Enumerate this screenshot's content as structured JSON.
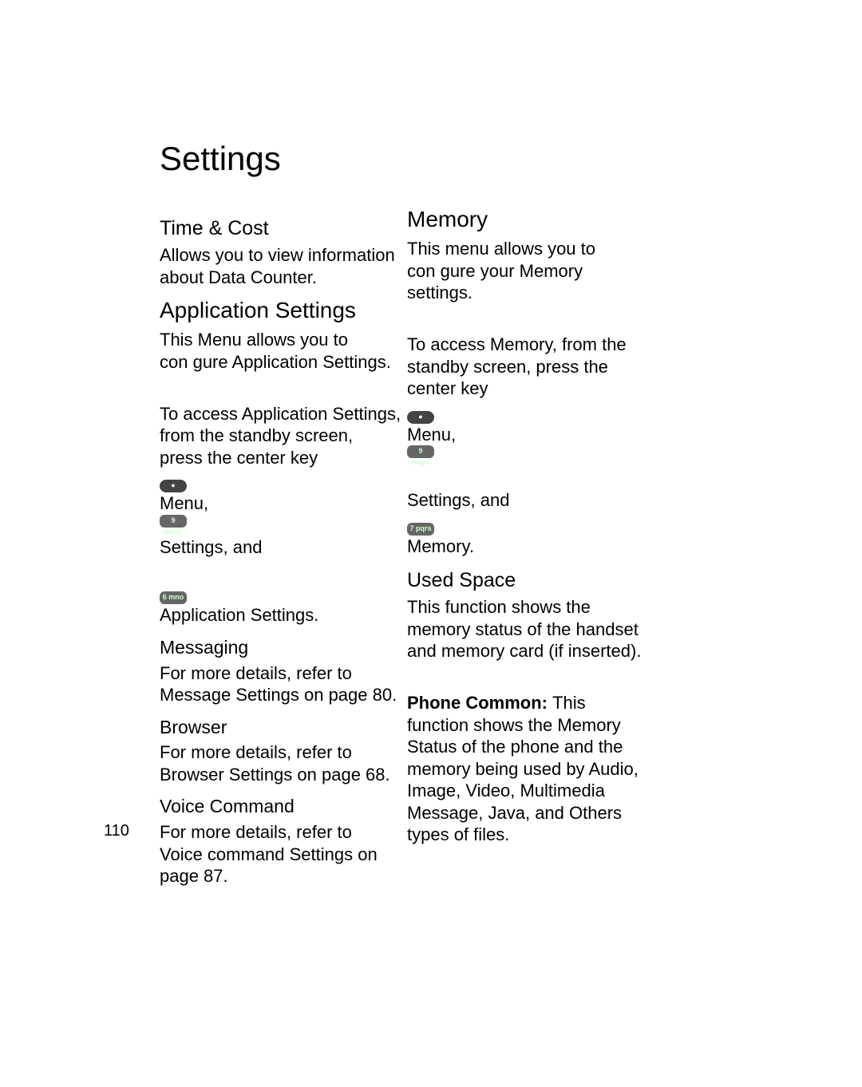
{
  "page_title": "Settings",
  "page_number": "110",
  "left": {
    "time_cost": {
      "heading": "Time & Cost",
      "body": "Allows you to view information\nabout Data Counter."
    },
    "app_settings": {
      "heading": "Application Settings",
      "body1": "This Menu allows you to\ncon gure Application Settings.",
      "body2a": "To access Application Settings,\nfrom the standby screen,\npress the center key",
      "body2b": "Menu,",
      "body2c": " Settings, and",
      "body2d": " Application Settings."
    },
    "messaging": {
      "heading": "Messaging",
      "body": "For more details, refer to\nMessage Settings on page 80."
    },
    "browser": {
      "heading": "Browser",
      "body": "For more details, refer to\nBrowser Settings on page 68."
    },
    "voice": {
      "heading": "Voice Command",
      "body": "For more details, refer to\nVoice command Settings on\npage 87."
    }
  },
  "right": {
    "memory": {
      "heading": "Memory",
      "body1": "This menu allows you to\ncon gure your Memory\nsettings.",
      "body2a": "To access Memory, from the\nstandby screen, press the\ncenter key",
      "body2b": " Menu,",
      "body2c": " Settings, and",
      "body2d": " Memory."
    },
    "used_space": {
      "heading": "Used Space",
      "body": "This function shows the\nmemory status of the handset\nand memory card (if inserted)."
    },
    "phone_common": {
      "label": "Phone Common: ",
      "body": "This\nfunction shows the Memory\nStatus of the phone and the\nmemory being used by Audio,\nImage, Video, Multimedia\nMessage, Java, and Others\ntypes of files."
    }
  },
  "keys": {
    "center": "●",
    "nine": "9 wxyz",
    "six": "6 mno",
    "seven": "7 pqrs"
  }
}
